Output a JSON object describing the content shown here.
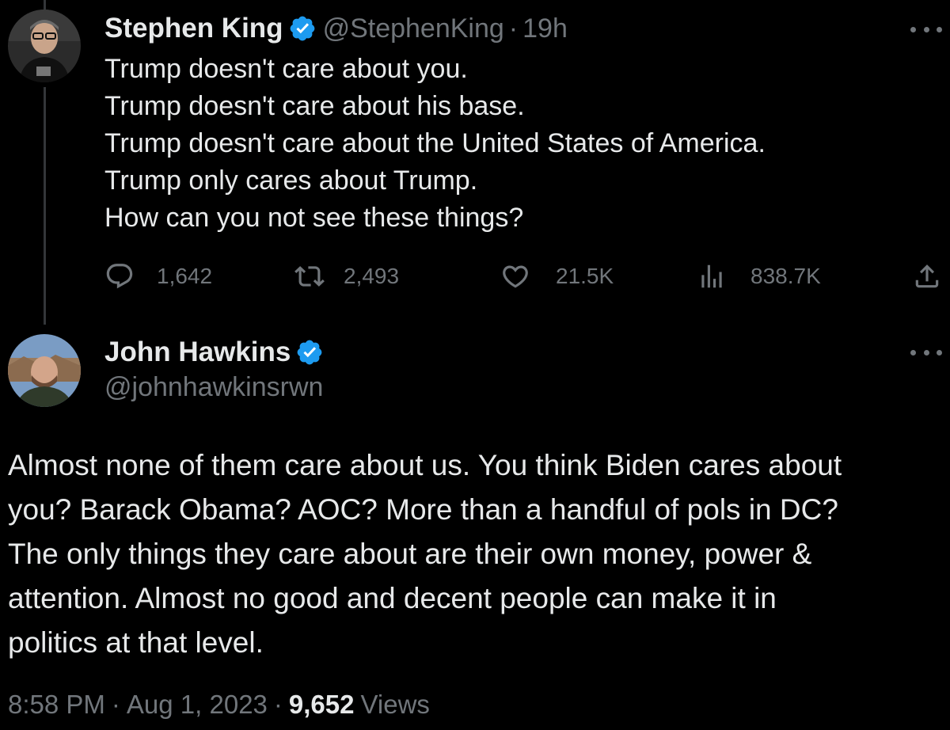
{
  "parent_tweet": {
    "display_name": "Stephen King",
    "handle": "@StephenKing",
    "separator": "·",
    "relative_time": "19h",
    "avatar_icon": "person-avatar-icon",
    "text_lines": [
      "Trump doesn't care about you.",
      "Trump doesn't care about his base.",
      "Trump doesn't care about the United States of America.",
      "Trump only cares about Trump.",
      "How can you not see these things?"
    ],
    "stats": {
      "replies": "1,642",
      "reposts": "2,493",
      "likes": "21.5K",
      "views": "838.7K"
    }
  },
  "reply_tweet": {
    "display_name": "John Hawkins",
    "handle": "@johnhawkinsrwn",
    "avatar_icon": "person-avatar-icon",
    "text_lines": [
      "Almost none of them care about us. You think Biden cares about",
      "you? Barack Obama? AOC? More than a handful of pols in DC?",
      "The only things they care about are their own money, power &",
      "attention. Almost no good and decent people can make it in",
      "politics at that level."
    ],
    "time": "8:58 PM",
    "separator": "·",
    "date": "Aug 1, 2023",
    "views_count": "9,652",
    "views_label": "Views"
  },
  "colors": {
    "background": "#000000",
    "text_primary": "#e7e9ea",
    "text_secondary": "#71767b",
    "verified_blue": "#1d9bf0",
    "thread_line": "#333639"
  },
  "icons": {
    "reply": "reply-icon",
    "repost": "repost-icon",
    "like": "heart-icon",
    "views": "views-chart-icon",
    "share": "share-icon",
    "more": "more-options-icon",
    "verified": "verified-badge-icon"
  }
}
